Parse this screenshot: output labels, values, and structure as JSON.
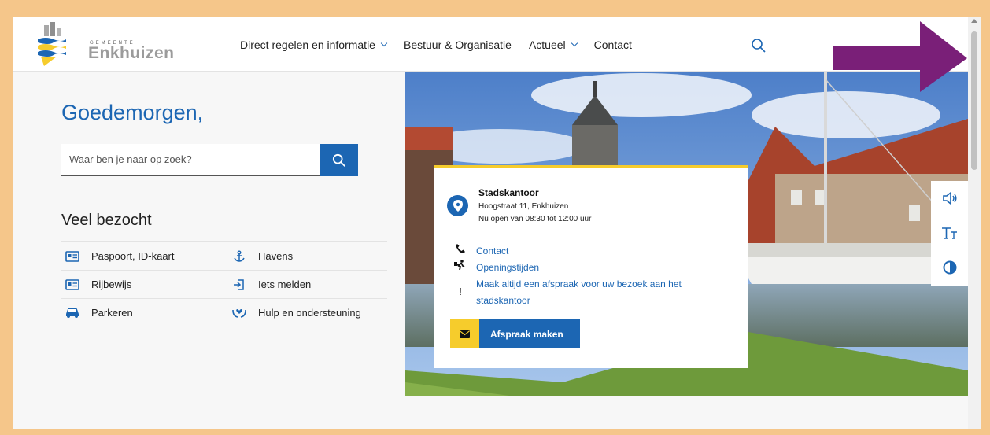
{
  "logo": {
    "small": "GEMEENTE",
    "name": "Enkhuizen"
  },
  "nav": [
    {
      "label": "Direct regelen en informatie",
      "has_dropdown": true
    },
    {
      "label": "Bestuur & Organisatie",
      "has_dropdown": false
    },
    {
      "label": "Actueel",
      "has_dropdown": true
    },
    {
      "label": "Contact",
      "has_dropdown": false
    }
  ],
  "main": {
    "greeting": "Goedemorgen,",
    "search_placeholder": "Waar ben je naar op zoek?",
    "visited_title": "Veel bezocht",
    "links": [
      {
        "label": "Paspoort, ID-kaart",
        "icon": "id-card-icon"
      },
      {
        "label": "Havens",
        "icon": "anchor-icon"
      },
      {
        "label": "Rijbewijs",
        "icon": "id-card-icon"
      },
      {
        "label": "Iets melden",
        "icon": "report-icon"
      },
      {
        "label": "Parkeren",
        "icon": "car-icon"
      },
      {
        "label": "Hulp en ondersteuning",
        "icon": "helping-hands-icon"
      }
    ]
  },
  "card": {
    "title": "Stadskantoor",
    "address": "Hoogstraat 11, Enkhuizen",
    "open": "Nu open van 08:30 tot 12:00 uur",
    "contact": "Contact",
    "hours": "Openingstijden",
    "notice_line1": "Maak altijd een afspraak voor uw bezoek aan het",
    "notice_line2": "stadskantoor",
    "notice_icon": "!",
    "cta": "Afspraak maken"
  },
  "colors": {
    "brand_blue": "#1c66b3",
    "accent_yellow": "#f6cc2c",
    "annotation_purple": "#7a1f78",
    "background_frame": "#f5c68a"
  }
}
